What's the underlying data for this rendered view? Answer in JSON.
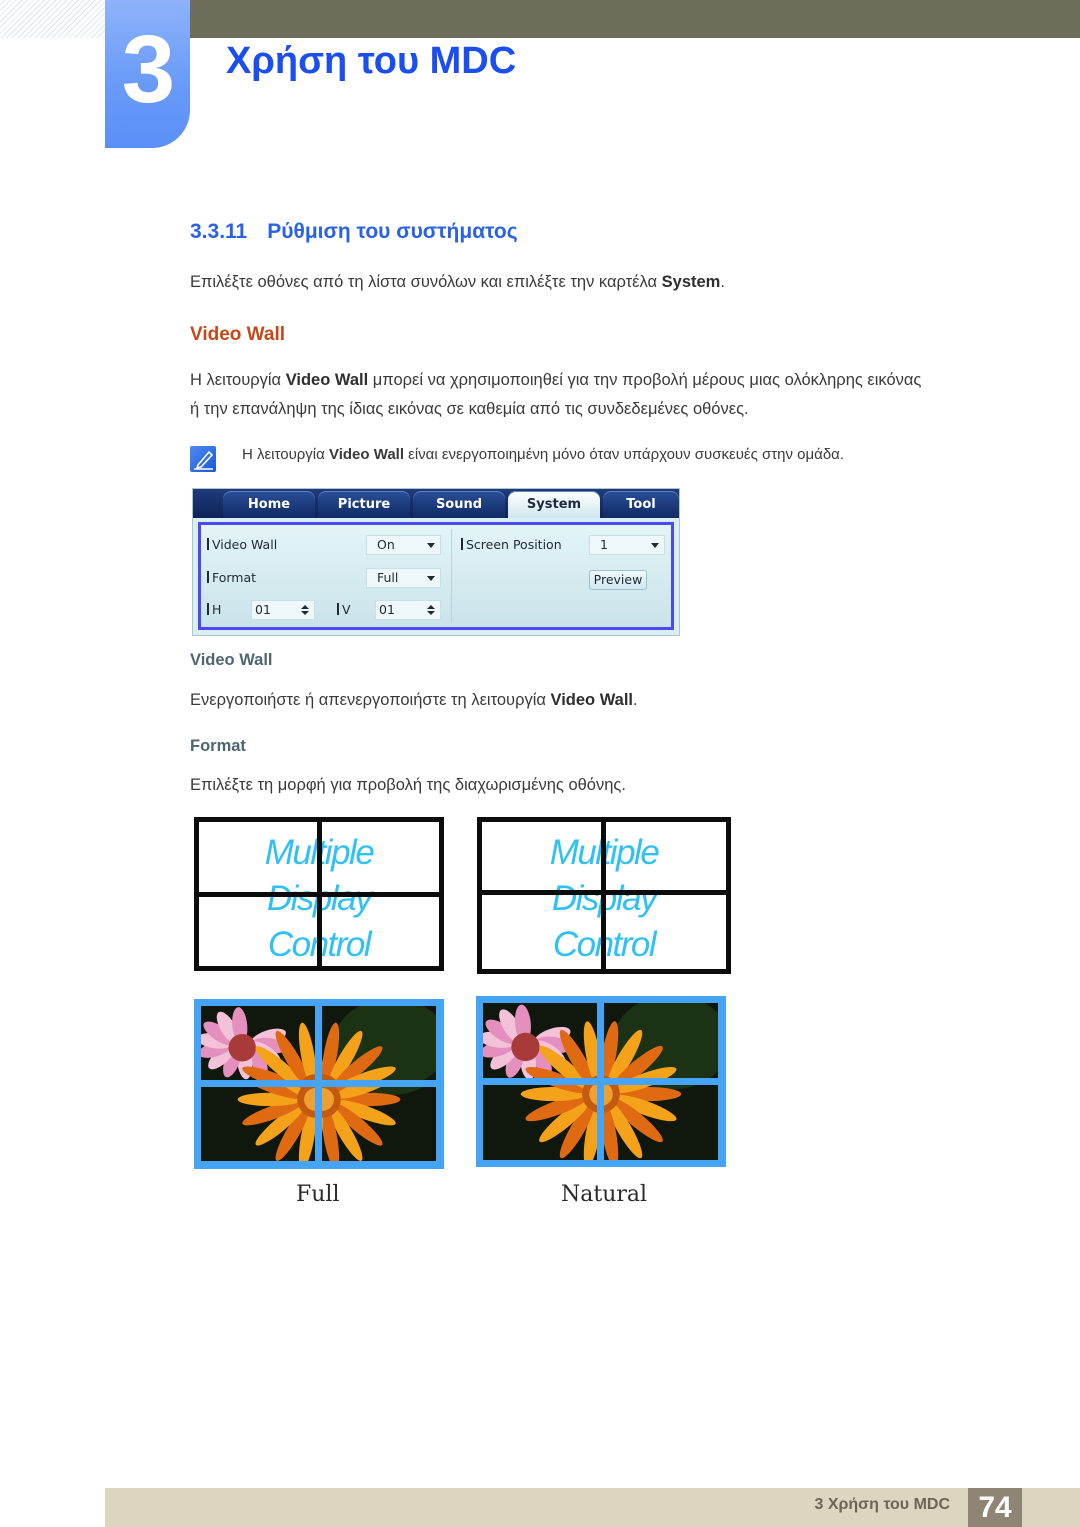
{
  "chapter": {
    "number": "3",
    "title": "Χρήση του MDC"
  },
  "section": {
    "number": "3.3.11",
    "title": "Ρύθμιση του συστήματος"
  },
  "intro": {
    "text": "Επιλέξτε οθόνες από τη λίστα συνόλων και επιλέξτε την καρτέλα ",
    "bold": "System",
    "end": "."
  },
  "video_wall_heading": "Video Wall",
  "video_wall_desc": {
    "line1_a": "Η λειτουργία ",
    "line1_bold": "Video Wall",
    "line1_b": " μπορεί να χρησιμοποιηθεί για την προβολή μέρους μιας ολόκληρης εικόνας",
    "line2": "ή την επανάληψη της ίδιας εικόνας σε καθεμία από τις συνδεδεμένες οθόνες."
  },
  "note": {
    "icon": "note-pencil-icon",
    "text_a": "Η λειτουργία ",
    "bold": "Video Wall",
    "text_b": " είναι ενεργοποιημένη μόνο όταν υπάρχουν συσκευές στην ομάδα."
  },
  "mdc_panel": {
    "tabs": [
      {
        "label": "Home",
        "active": false
      },
      {
        "label": "Picture",
        "active": false
      },
      {
        "label": "Sound",
        "active": false
      },
      {
        "label": "System",
        "active": true
      },
      {
        "label": "Tool",
        "active": false
      }
    ],
    "video_wall_label": "Video Wall",
    "video_wall_value": "On",
    "format_label": "Format",
    "format_value": "Full",
    "h_label": "H",
    "h_value": "01",
    "v_label": "V",
    "v_value": "01",
    "screen_position_label": "Screen Position",
    "screen_position_value": "1",
    "preview_label": "Preview",
    "highlight_color": "#4b49ef"
  },
  "video_wall_sub": {
    "heading": "Video Wall",
    "text_a": "Ενεργοποιήστε ή απενεργοποιήστε τη λειτουργία ",
    "bold": "Video Wall",
    "end": "."
  },
  "format_sub": {
    "heading": "Format",
    "text": "Επιλέξτε τη μορφή για προβολή της διαχωρισμένης οθόνης."
  },
  "illustrations": {
    "logo_lines": [
      "Multiple",
      "Display",
      "Control"
    ],
    "captions": [
      "Full",
      "Natural"
    ]
  },
  "footer": {
    "text": "3 Χρήση του MDC",
    "page": "74"
  }
}
